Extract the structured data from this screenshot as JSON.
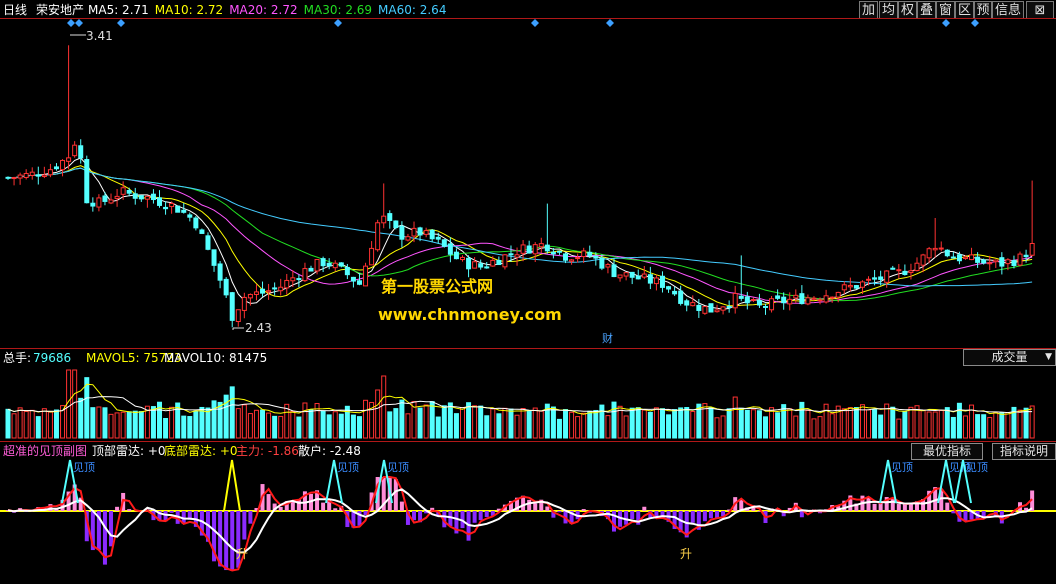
{
  "header": {
    "period": "日线",
    "stock": "荣安地产",
    "ma": [
      {
        "label": "MA5: 2.71",
        "color": "#ffffff"
      },
      {
        "label": "MA10: 2.72",
        "color": "#ffff00"
      },
      {
        "label": "MA20: 2.72",
        "color": "#ff55ff"
      },
      {
        "label": "MA30: 2.69",
        "color": "#22dd22"
      },
      {
        "label": "MA60: 2.64",
        "color": "#44ccff"
      }
    ]
  },
  "toolbar": [
    "加",
    "均",
    "权",
    "叠",
    "窗",
    "区",
    "预",
    "信息"
  ],
  "price": {
    "high_label": "3.41",
    "low_label": "2.43",
    "news_badge": "财",
    "watermark_1": "第一股票公式网",
    "watermark_2": "www.chnmoney.com"
  },
  "volume": {
    "total_label": "总手:",
    "total_value": "79686",
    "mavol5": "MAVOL5: 75723",
    "mavol10": "MAVOL10: 81475",
    "dropdown": "成交量"
  },
  "indicator": {
    "name": "超准的见顶副图",
    "top_radar": "顶部雷达: +0",
    "bottom_radar": "底部雷达: +0",
    "main_force": "主力: -1.86",
    "retail": "散户: -2.48",
    "best_button": "最优指标",
    "help_button": "指标说明",
    "top_signal": "见顶",
    "up_signal": "升"
  },
  "colors": {
    "up": "#ff3232",
    "down": "#54ffff",
    "divider": "#b01818",
    "ma5": "#ffffff",
    "ma10": "#ffff00",
    "ma20": "#ff55ff",
    "ma30": "#22dd22",
    "ma60": "#44ccff"
  }
}
